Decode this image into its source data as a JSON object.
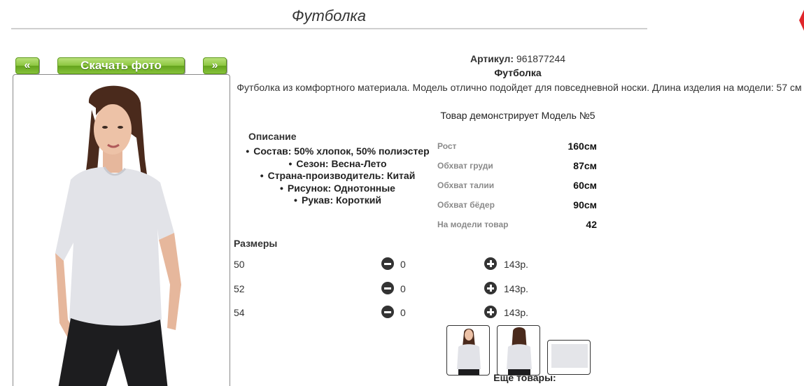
{
  "page": {
    "title": "Футболка"
  },
  "photo_nav": {
    "prev_label": "«",
    "download_label": "Скачать фото",
    "next_label": "»"
  },
  "product": {
    "sku_label": "Артикул:",
    "sku_value": "961877244",
    "name": "Футболка",
    "description": "Футболка из комфортного материала. Модель отлично подойдет для повседневной носки. Длина изделия на модели: 57 см",
    "model_note": "Товар демонстрирует Модель №5"
  },
  "specs": {
    "title": "Описание",
    "items": [
      "Состав: 50% хлопок, 50% полиэстер",
      "Сезон: Весна-Лето",
      "Страна-производитель: Китай",
      "Рисунок: Однотонные",
      "Рукав: Короткий"
    ]
  },
  "model_measurements": [
    {
      "label": "Рост",
      "value": "160см"
    },
    {
      "label": "Обхват груди",
      "value": "87см"
    },
    {
      "label": "Обхват талии",
      "value": "60см"
    },
    {
      "label": "Обхват бёдер",
      "value": "90см"
    },
    {
      "label": "На модели товар",
      "value": "42"
    }
  ],
  "sizes": {
    "title": "Размеры",
    "rows": [
      {
        "size": "50",
        "quantity": "0",
        "price": "143р."
      },
      {
        "size": "52",
        "quantity": "0",
        "price": "143р."
      },
      {
        "size": "54",
        "quantity": "0",
        "price": "143р."
      }
    ]
  },
  "more": {
    "label": "Ещё товары:"
  },
  "icons": {
    "prev": "double-chevron-left-icon",
    "next": "double-chevron-right-icon",
    "decrease": "minus-circle-icon",
    "increase": "plus-circle-icon"
  },
  "colors": {
    "accent_green": "#8cc63f",
    "text": "#333333",
    "muted_label": "#8a8a8a",
    "corner_mark": "#e0262b"
  }
}
